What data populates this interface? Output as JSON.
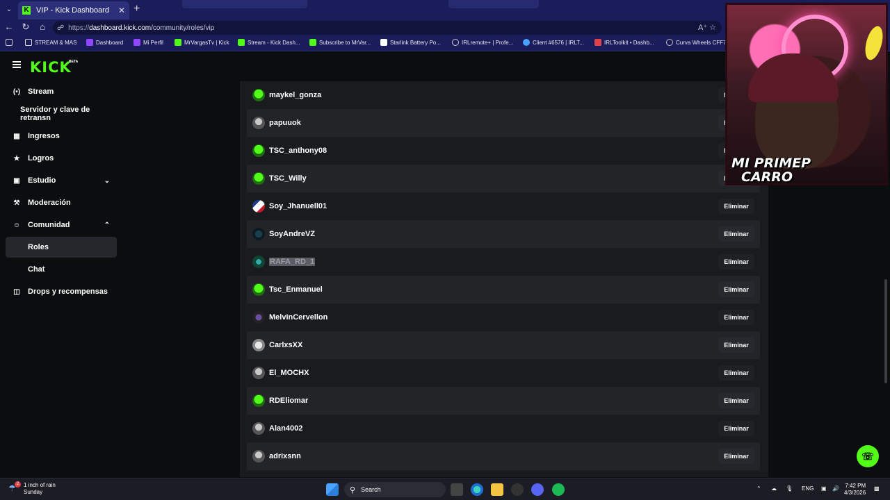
{
  "browser": {
    "tab_title": "VIP - Kick Dashboard",
    "url_proto": "https://",
    "url_host": "dashboard.kick.com",
    "url_path": "/community/roles/vip",
    "bookmarks": [
      {
        "label": "STREAM & MAS",
        "color": "#d9d9d9"
      },
      {
        "label": "Dashboard",
        "color": "#9146ff"
      },
      {
        "label": "Mi Perfil",
        "color": "#9146ff"
      },
      {
        "label": "MrVargasTv | Kick",
        "color": "#53fc18"
      },
      {
        "label": "Stream - Kick Dash...",
        "color": "#53fc18"
      },
      {
        "label": "Subscribe to MrVar...",
        "color": "#53fc18"
      },
      {
        "label": "Starlink Battery Po...",
        "color": "#ffffff"
      },
      {
        "label": "IRLremote+ | Profe...",
        "color": "#cccccc"
      },
      {
        "label": "Client #6576 | IRLT...",
        "color": "#4aa3ff"
      },
      {
        "label": "IRLToolkit • Dashb...",
        "color": "#e0444a"
      },
      {
        "label": "Curva Wheels CFF76",
        "color": "#bbbbbb"
      }
    ]
  },
  "header": {
    "logo": "KICK",
    "beta": "BETA"
  },
  "sidebar": {
    "items": [
      {
        "label": "Stream",
        "icon": "broadcast-icon"
      },
      {
        "label": "Servidor y clave de retransn"
      },
      {
        "label": "Ingresos",
        "icon": "chart-icon"
      },
      {
        "label": "Logros",
        "icon": "trophy-icon"
      },
      {
        "label": "Estudio",
        "icon": "studio-icon"
      },
      {
        "label": "Moderación",
        "icon": "wrench-icon"
      },
      {
        "label": "Comunidad",
        "icon": "community-icon"
      },
      {
        "label": "Roles"
      },
      {
        "label": "Chat"
      },
      {
        "label": "Drops y recompensas",
        "icon": "gift-icon"
      }
    ]
  },
  "vip_list": {
    "remove_label": "Eliminar",
    "users": [
      {
        "name": "maykel_gonza",
        "avatar": "green"
      },
      {
        "name": "papuuok",
        "avatar": "gray"
      },
      {
        "name": "TSC_anthony08",
        "avatar": "green"
      },
      {
        "name": "TSC_Willy",
        "avatar": "green"
      },
      {
        "name": "Soy_Jhanuell01",
        "avatar": "flag"
      },
      {
        "name": "SoyAndreVZ",
        "avatar": "dark"
      },
      {
        "name": "RAFA_RD_1",
        "avatar": "teal"
      },
      {
        "name": "Tsc_Enmanuel",
        "avatar": "green"
      },
      {
        "name": "MelvinCervellon",
        "avatar": "purple"
      },
      {
        "name": "CarlxsXX",
        "avatar": "white"
      },
      {
        "name": "El_MOCHX",
        "avatar": "gray"
      },
      {
        "name": "RDEliomar",
        "avatar": "green"
      },
      {
        "name": "Alan4002",
        "avatar": "gray"
      },
      {
        "name": "adrixsnn",
        "avatar": "gray"
      }
    ]
  },
  "webcam": {
    "overlay_line1": "MI PRIMEP",
    "overlay_line2": "CARRO"
  },
  "taskbar": {
    "weather_line1": "1 inch of rain",
    "weather_line2": "Sunday",
    "weather_badge": "2",
    "search_label": "Search",
    "lang": "ENG",
    "time": "7:42 PM",
    "date": "4/3/2026"
  }
}
